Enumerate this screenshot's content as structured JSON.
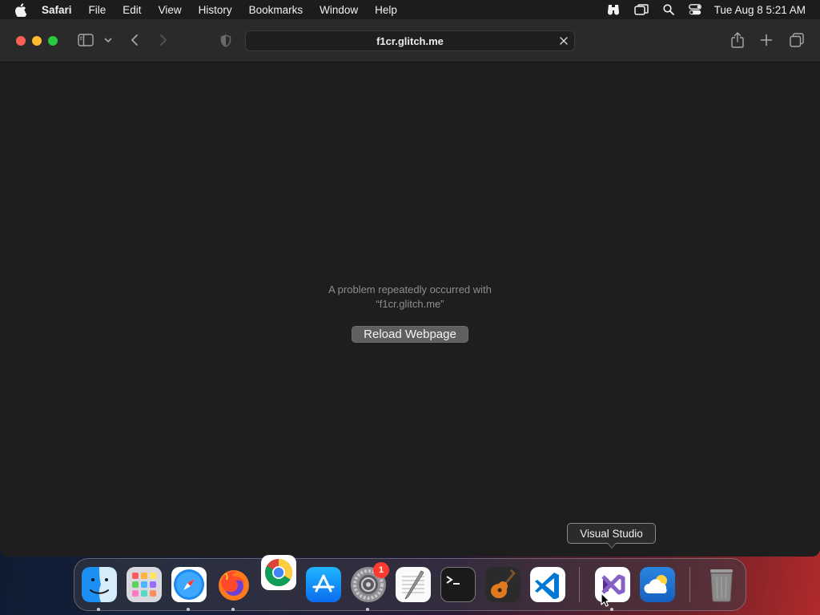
{
  "menubar": {
    "app_name": "Safari",
    "items": [
      "File",
      "Edit",
      "View",
      "History",
      "Bookmarks",
      "Window",
      "Help"
    ],
    "clock": "Tue Aug 8  5:21 AM"
  },
  "toolbar": {
    "url": "f1cr.glitch.me"
  },
  "error": {
    "line1": "A problem repeatedly occurred with",
    "line2": "“f1cr.glitch.me”",
    "reload_label": "Reload Webpage"
  },
  "tooltip": {
    "text": "Visual Studio"
  },
  "dock": {
    "apps": [
      "finder",
      "launchpad",
      "safari",
      "firefox",
      "chrome",
      "app-store",
      "system-settings",
      "textedit",
      "terminal",
      "garageband",
      "vscode",
      "visual-studio",
      "weather",
      "trash"
    ],
    "system_settings_badge": "1"
  },
  "colors": {
    "close": "#fe5f57",
    "minimize": "#febc2e",
    "maximize": "#28c840",
    "badge": "#ff3b30"
  }
}
